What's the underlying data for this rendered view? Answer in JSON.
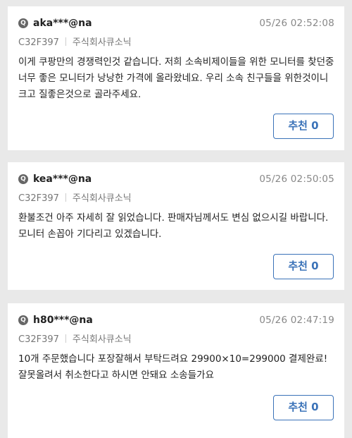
{
  "reviews": [
    {
      "avatar_letter": "Q",
      "username": "aka***@na",
      "timestamp": "05/26 02:52:08",
      "product_code": "C32F397",
      "seller": "주식회사큐소닉",
      "body": "이게 쿠팡만의 경쟁력인것 같습니다. 저희 소속비제이들을 위한 모니터를 찾던중 너무 좋은 모니터가 낭낭한 가격에 올라왔네요. 우리 소속 친구들을 위한것이니 크고 질좋은것으로 골라주세요.",
      "recommend_label": "추천 0"
    },
    {
      "avatar_letter": "Q",
      "username": "kea***@na",
      "timestamp": "05/26 02:50:05",
      "product_code": "C32F397",
      "seller": "주식회사큐소닉",
      "body": "환불조건 아주 자세히 잘 읽었습니다. 판매자님께서도 변심 없으시길 바랍니다. 모니터 손꼽아 기다리고 있겠습니다.",
      "recommend_label": "추천 0"
    },
    {
      "avatar_letter": "Q",
      "username": "h80***@na",
      "timestamp": "05/26 02:47:19",
      "product_code": "C32F397",
      "seller": "주식회사큐소닉",
      "body": "10개 주문했습니다 포장잘해서 부탁드려요 29900×10=299000 결제완료! 잘못올려서 취소한다고 하시면 안돼요 소송들가요",
      "recommend_label": "추천 0"
    }
  ],
  "colors": {
    "background": "#e9e9e9",
    "card": "#ffffff",
    "accent": "#3a72b8",
    "timestamp": "#888888"
  }
}
